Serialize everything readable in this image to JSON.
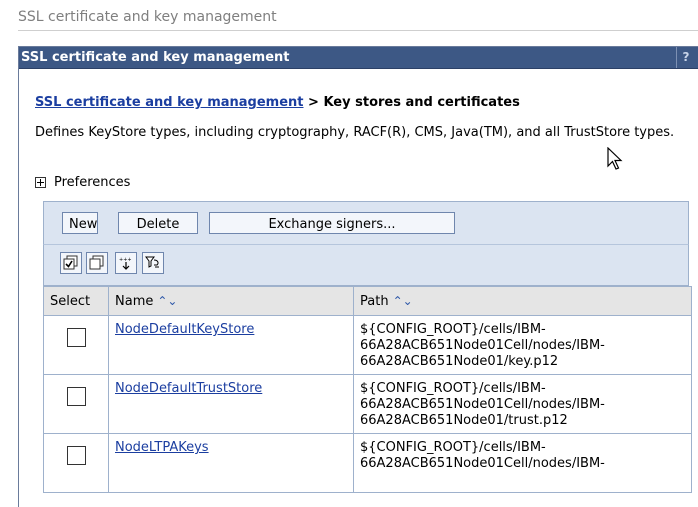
{
  "page_title": "SSL certificate and key management",
  "panel": {
    "title": "SSL certificate and key management",
    "help_label": "?"
  },
  "breadcrumb": {
    "link": "SSL certificate and key management",
    "separator": " > ",
    "current": "Key stores and certificates"
  },
  "description": "Defines KeyStore types, including cryptography, RACF(R), CMS, Java(TM), and all TrustStore types.",
  "preferences_label": "Preferences",
  "toolbar": {
    "new_label": "New",
    "delete_label": "Delete",
    "exchange_label": "Exchange signers..."
  },
  "icons": [
    "select-all-icon",
    "deselect-all-icon",
    "show-filter-icon",
    "clear-filter-icon"
  ],
  "table": {
    "headers": {
      "select": "Select",
      "name": "Name",
      "name_sort": "⌃⌄",
      "path": "Path",
      "path_sort": "⌃⌄"
    },
    "rows": [
      {
        "name": "NodeDefaultKeyStore",
        "path": "${CONFIG_ROOT}/cells/IBM-66A28ACB651Node01Cell/nodes/IBM-66A28ACB651Node01/key.p12"
      },
      {
        "name": "NodeDefaultTrustStore",
        "path": "${CONFIG_ROOT}/cells/IBM-66A28ACB651Node01Cell/nodes/IBM-66A28ACB651Node01/trust.p12"
      },
      {
        "name": "NodeLTPAKeys",
        "path": "${CONFIG_ROOT}/cells/IBM-66A28ACB651Node01Cell/nodes/IBM-"
      }
    ]
  },
  "colors": {
    "header_bg": "#3d5885",
    "link": "#1b3ea0",
    "toolbar_bg": "#dbe4f1"
  }
}
